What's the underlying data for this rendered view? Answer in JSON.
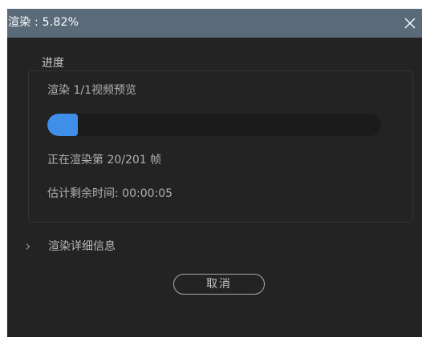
{
  "window": {
    "title": "渲染 : 5.82%",
    "close_icon": "close-icon"
  },
  "progress_group": {
    "legend": "进度",
    "render_target": "渲染 1/1视频预览",
    "progress_fraction": 0.0582,
    "frame_status": "正在渲染第 20/201 帧",
    "time_remaining": "估计剩余时间: 00:00:05",
    "accent_color": "#3f8ee8"
  },
  "details": {
    "label": "渲染详细信息",
    "icon": "chevron-right-icon"
  },
  "buttons": {
    "cancel": "取消"
  }
}
